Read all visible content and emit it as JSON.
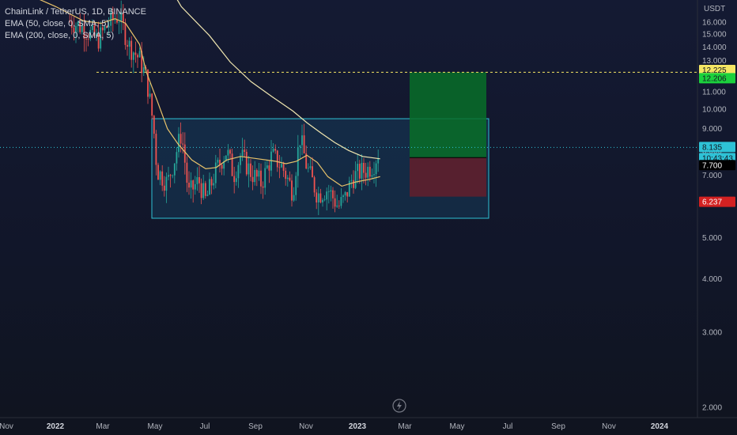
{
  "chart_data": {
    "type": "candlestick",
    "title": "ChainLink / TetherUS, 1D, BINANCE",
    "indicators": [
      "EMA (50, close, 0, SMA, 5)",
      "EMA (200, close, 0, SMA, 5)"
    ],
    "y_axis_title": "USDT",
    "y_ticks": [
      "16.000",
      "15.000",
      "14.000",
      "13.000",
      "12.000",
      "11.000",
      "10.000",
      "9.000",
      "8.000",
      "7.000",
      "6.000",
      "5.000",
      "4.000",
      "3.000",
      "2.000"
    ],
    "y_values": [
      16,
      15,
      14,
      13,
      12,
      11,
      10,
      9,
      8,
      7,
      6,
      5,
      4,
      3,
      2
    ],
    "x_ticks": [
      {
        "label": "Nov",
        "bold": false
      },
      {
        "label": "2022",
        "bold": true
      },
      {
        "label": "Mar",
        "bold": false
      },
      {
        "label": "May",
        "bold": false
      },
      {
        "label": "Jul",
        "bold": false
      },
      {
        "label": "Sep",
        "bold": false
      },
      {
        "label": "Nov",
        "bold": false
      },
      {
        "label": "2023",
        "bold": true
      },
      {
        "label": "Mar",
        "bold": false
      },
      {
        "label": "May",
        "bold": false
      },
      {
        "label": "Jul",
        "bold": false
      },
      {
        "label": "Sep",
        "bold": false
      },
      {
        "label": "Nov",
        "bold": false
      },
      {
        "label": "2024",
        "bold": true
      }
    ],
    "price_labels": [
      {
        "value": "12.225",
        "color": "#f5e663",
        "text_color": "#131722"
      },
      {
        "value": "12.206",
        "color": "#1bd13d",
        "text_color": "#131722"
      },
      {
        "value": "8.135",
        "color": "#2ec2d6",
        "text_color": "#131722"
      },
      {
        "value": "10:43:43",
        "color": "#2ec2d6",
        "text_color": "#131722"
      },
      {
        "value": "7.700",
        "color": "#000000",
        "text_color": "#ffffff"
      },
      {
        "value": "6.237",
        "color": "#d32121",
        "text_color": "#ffffff"
      }
    ],
    "levels": {
      "target": 12.206,
      "entry": 7.7,
      "stop": 6.237,
      "current": 8.135,
      "range_top": 9.5,
      "range_bottom": 5.55
    },
    "ema50": [
      [
        0.03,
        18.9
      ],
      [
        0.08,
        17.4
      ],
      [
        0.12,
        16.1
      ],
      [
        0.145,
        15.9
      ],
      [
        0.165,
        16.3
      ],
      [
        0.18,
        15.9
      ],
      [
        0.2,
        14.2
      ],
      [
        0.21,
        12.2
      ],
      [
        0.225,
        10.5
      ],
      [
        0.24,
        9.0
      ],
      [
        0.255,
        8.3
      ],
      [
        0.275,
        7.6
      ],
      [
        0.295,
        7.25
      ],
      [
        0.31,
        7.3
      ],
      [
        0.325,
        7.6
      ],
      [
        0.345,
        7.75
      ],
      [
        0.37,
        7.65
      ],
      [
        0.395,
        7.55
      ],
      [
        0.41,
        7.45
      ],
      [
        0.425,
        7.55
      ],
      [
        0.44,
        7.8
      ],
      [
        0.455,
        7.5
      ],
      [
        0.47,
        6.95
      ],
      [
        0.49,
        6.6
      ],
      [
        0.51,
        6.75
      ],
      [
        0.53,
        6.85
      ],
      [
        0.545,
        6.95
      ]
    ],
    "ema200": [
      [
        0.22,
        22.5
      ],
      [
        0.26,
        17.4
      ],
      [
        0.3,
        14.9
      ],
      [
        0.33,
        12.9
      ],
      [
        0.36,
        11.6
      ],
      [
        0.39,
        10.7
      ],
      [
        0.42,
        9.9
      ],
      [
        0.44,
        9.3
      ],
      [
        0.46,
        8.8
      ],
      [
        0.48,
        8.35
      ],
      [
        0.5,
        8.0
      ],
      [
        0.52,
        7.75
      ],
      [
        0.545,
        7.65
      ]
    ],
    "closes": [
      [
        0.1,
        16.1
      ],
      [
        0.12,
        15.5
      ],
      [
        0.14,
        14.5
      ],
      [
        0.155,
        15.8
      ],
      [
        0.17,
        16.6
      ],
      [
        0.185,
        14.1
      ],
      [
        0.2,
        13.1
      ],
      [
        0.21,
        11.8
      ],
      [
        0.22,
        9.1
      ],
      [
        0.225,
        7.2
      ],
      [
        0.24,
        6.7
      ],
      [
        0.25,
        7.6
      ],
      [
        0.26,
        8.8
      ],
      [
        0.27,
        6.3
      ],
      [
        0.285,
        6.8
      ],
      [
        0.295,
        6.1
      ],
      [
        0.31,
        7.2
      ],
      [
        0.325,
        8.0
      ],
      [
        0.335,
        7.0
      ],
      [
        0.345,
        7.8
      ],
      [
        0.36,
        7.1
      ],
      [
        0.375,
        6.7
      ],
      [
        0.39,
        7.8
      ],
      [
        0.405,
        7.3
      ],
      [
        0.42,
        6.4
      ],
      [
        0.43,
        8.6
      ],
      [
        0.44,
        7.3
      ],
      [
        0.455,
        6.3
      ],
      [
        0.47,
        6.5
      ],
      [
        0.485,
        5.9
      ],
      [
        0.495,
        6.2
      ],
      [
        0.505,
        6.9
      ],
      [
        0.515,
        7.1
      ],
      [
        0.525,
        7.2
      ],
      [
        0.535,
        7.4
      ],
      [
        0.545,
        8.1
      ]
    ]
  }
}
